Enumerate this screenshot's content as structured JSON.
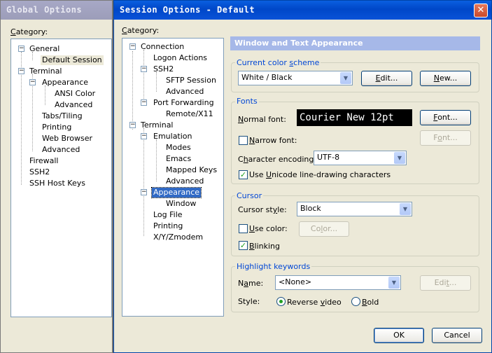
{
  "global_options": {
    "title": "Global Options",
    "category_label": "Category:",
    "tree": [
      {
        "label": "General"
      },
      {
        "label": "Default Session"
      },
      {
        "label": "Terminal"
      },
      {
        "label": "Appearance"
      },
      {
        "label": "ANSI Color"
      },
      {
        "label": "Advanced"
      },
      {
        "label": "Tabs/Tiling"
      },
      {
        "label": "Printing"
      },
      {
        "label": "Web Browser"
      },
      {
        "label": "Advanced"
      },
      {
        "label": "Firewall"
      },
      {
        "label": "SSH2"
      },
      {
        "label": "SSH Host Keys"
      }
    ]
  },
  "session_options": {
    "title": "Session Options - Default",
    "close_glyph": "✕",
    "category_label": "Category:",
    "tree": [
      {
        "label": "Connection"
      },
      {
        "label": "Logon Actions"
      },
      {
        "label": "SSH2"
      },
      {
        "label": "SFTP Session"
      },
      {
        "label": "Advanced"
      },
      {
        "label": "Port Forwarding"
      },
      {
        "label": "Remote/X11"
      },
      {
        "label": "Terminal"
      },
      {
        "label": "Emulation"
      },
      {
        "label": "Modes"
      },
      {
        "label": "Emacs"
      },
      {
        "label": "Mapped Keys"
      },
      {
        "label": "Advanced"
      },
      {
        "label": "Appearance"
      },
      {
        "label": "Window"
      },
      {
        "label": "Log File"
      },
      {
        "label": "Printing"
      },
      {
        "label": "X/Y/Zmodem"
      }
    ]
  },
  "panel": {
    "banner": "Window and Text Appearance",
    "color_scheme": {
      "group": "Current color scheme",
      "value": "White / Black",
      "edit": "Edit...",
      "new": "New..."
    },
    "fonts": {
      "group": "Fonts",
      "normal_font_label": "Normal font:",
      "normal_font_preview": "Courier New 12pt",
      "font_button": "Font...",
      "narrow_font_label": "Narrow font:",
      "narrow_font_checked": false,
      "narrow_font_button": "Font...",
      "encoding_label": "Character encoding:",
      "encoding_value": "UTF-8",
      "unicode_label": "Use Unicode line-drawing characters",
      "unicode_checked": true
    },
    "cursor": {
      "group": "Cursor",
      "style_label": "Cursor style:",
      "style_value": "Block",
      "use_color_label": "Use color:",
      "use_color_checked": false,
      "color_button": "Color...",
      "blinking_label": "Blinking",
      "blinking_checked": true
    },
    "highlight": {
      "group": "Highlight keywords",
      "name_label": "Name:",
      "name_value": "<None>",
      "edit": "Edit...",
      "style_label": "Style:",
      "reverse_label": "Reverse video",
      "bold_label": "Bold",
      "selected_style": "Reverse video"
    }
  },
  "footer": {
    "ok": "OK",
    "cancel": "Cancel"
  },
  "icons": {
    "check": "✓",
    "dropdown": "▼",
    "minus": "−"
  },
  "colors": {
    "title_active": "#0a5fe0",
    "title_inactive": "#9c9db9",
    "selection": "#316ac5",
    "group_label": "#0046d5",
    "banner": "#a6b8e8"
  }
}
